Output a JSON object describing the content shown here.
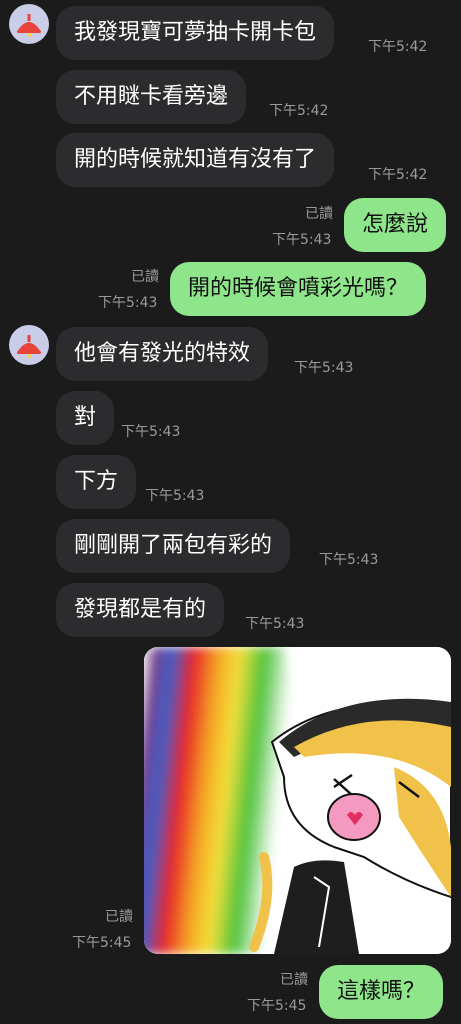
{
  "colors": {
    "background": "#1b1b1b",
    "incoming_bubble": "#2c2c2e",
    "outgoing_bubble": "#8fe58a",
    "meta_text": "#9a9a9a"
  },
  "messages": [
    {
      "dir": "in",
      "avatar": true,
      "text": "我發現寶可夢抽卡開卡包",
      "time": "下午5:42"
    },
    {
      "dir": "in",
      "text": "不用瞇卡看旁邊",
      "time": "下午5:42"
    },
    {
      "dir": "in",
      "text": "開的時候就知道有沒有了",
      "time": "下午5:42"
    },
    {
      "dir": "out",
      "text": "怎麼說",
      "read": "已讀",
      "time": "下午5:43"
    },
    {
      "dir": "out",
      "text": "開的時候會噴彩光嗎？",
      "read": "已讀",
      "time": "下午5:43"
    },
    {
      "dir": "in",
      "avatar": true,
      "text": "他會有發光的特效",
      "time": "下午5:43"
    },
    {
      "dir": "in",
      "text": "對",
      "time": "下午5:43"
    },
    {
      "dir": "in",
      "text": "下方",
      "time": "下午5:43"
    },
    {
      "dir": "in",
      "text": "剛剛開了兩包有彩的",
      "time": "下午5:43"
    },
    {
      "dir": "in",
      "text": "發現都是有的",
      "time": "下午5:43"
    },
    {
      "dir": "out",
      "image": "rainbow-sticker",
      "read": "已讀",
      "time": "下午5:45"
    },
    {
      "dir": "out",
      "text": "這樣嗎？",
      "read": "已讀",
      "time": "下午5:45"
    }
  ]
}
